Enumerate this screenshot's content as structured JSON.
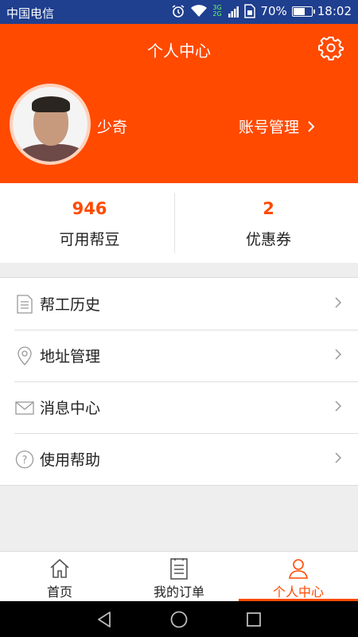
{
  "status_bar": {
    "carrier": "中国电信",
    "network": "3G 2G",
    "battery": "70%",
    "battery_level": 0.7,
    "time": "18:02"
  },
  "header": {
    "title": "个人中心",
    "username": "少奇",
    "account_link": "账号管理"
  },
  "stats": [
    {
      "value": "946",
      "label": "可用帮豆"
    },
    {
      "value": "2",
      "label": "优惠券"
    }
  ],
  "menu": [
    {
      "label": "帮工历史",
      "icon": "document-icon"
    },
    {
      "label": "地址管理",
      "icon": "location-pin-icon"
    },
    {
      "label": "消息中心",
      "icon": "envelope-icon"
    },
    {
      "label": "使用帮助",
      "icon": "question-circle-icon"
    }
  ],
  "tabs": [
    {
      "label": "首页",
      "icon": "home-icon"
    },
    {
      "label": "我的订单",
      "icon": "order-list-icon"
    },
    {
      "label": "个人中心",
      "icon": "person-icon",
      "active": true
    }
  ],
  "colors": {
    "accent": "#ff4a00",
    "status_bar": "#1f3f8f"
  }
}
